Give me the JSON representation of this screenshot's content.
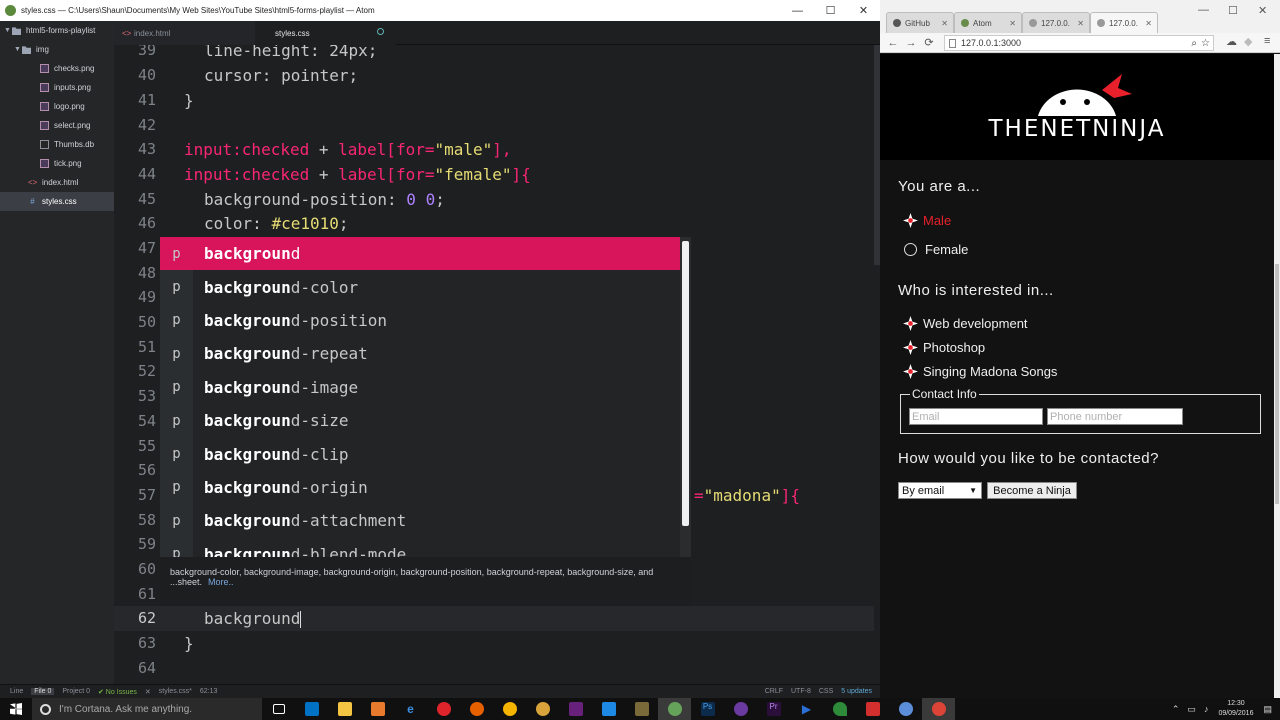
{
  "atom": {
    "title": "styles.css — C:\\Users\\Shaun\\Documents\\My Web Sites\\YouTube Sites\\html5-forms-playlist — Atom",
    "window_controls": {
      "minimize": "—",
      "maximize": "☐",
      "close": "✕"
    },
    "tree": {
      "root": "html5-forms-playlist",
      "folder": "img",
      "files": [
        "checks.png",
        "inputs.png",
        "logo.png",
        "select.png",
        "Thumbs.db",
        "tick.png"
      ],
      "root_files": [
        "index.html",
        "styles.css"
      ]
    },
    "tabs": [
      {
        "label": "index.html",
        "active": false
      },
      {
        "label": "styles.css",
        "active": true
      }
    ],
    "lines": {
      "l39": {
        "num": "39",
        "text": "line-height: 24px;"
      },
      "l40": {
        "num": "40",
        "prop": "cursor",
        "value": "pointer"
      },
      "l41": {
        "num": "41",
        "text": "}"
      },
      "l42": {
        "num": "42"
      },
      "l43": {
        "num": "43",
        "sel1": "input:checked",
        "plus": " + ",
        "sel2": "label[for=",
        "attr": "\"male\"",
        "end": "],"
      },
      "l44": {
        "num": "44",
        "sel1": "input:checked",
        "plus": " + ",
        "sel2": "label[for=",
        "attr": "\"female\"",
        "end": "]{"
      },
      "l45": {
        "num": "45",
        "prop": "background-position",
        "value": "0 0"
      },
      "l46": {
        "num": "46",
        "prop": "color",
        "value": "#ce1010"
      },
      "l47": {
        "num": "47"
      },
      "l48": {
        "num": "48"
      },
      "l49": {
        "num": "49"
      },
      "l50": {
        "num": "50"
      },
      "l51": {
        "num": "51"
      },
      "l52": {
        "num": "52"
      },
      "l53": {
        "num": "53"
      },
      "l54": {
        "num": "54"
      },
      "l55": {
        "num": "55"
      },
      "l56": {
        "num": "56"
      },
      "l57": {
        "num": "57",
        "tail_attr": "\"madona\"",
        "tail_end": "]{"
      },
      "l58": {
        "num": "58"
      },
      "l59": {
        "num": "59"
      },
      "l60": {
        "num": "60"
      },
      "l61": {
        "num": "61"
      },
      "l62": {
        "num": "62",
        "text": "background"
      },
      "l63": {
        "num": "63",
        "text": "}"
      },
      "l64": {
        "num": "64"
      }
    },
    "autocomplete": {
      "type_tag": "p",
      "typed": "backgroun",
      "items": [
        {
          "match": "backgroun",
          "rest": "d"
        },
        {
          "match": "backgroun",
          "rest": "d-color"
        },
        {
          "match": "backgroun",
          "rest": "d-position"
        },
        {
          "match": "backgroun",
          "rest": "d-repeat"
        },
        {
          "match": "backgroun",
          "rest": "d-image"
        },
        {
          "match": "backgroun",
          "rest": "d-size"
        },
        {
          "match": "backgroun",
          "rest": "d-clip"
        },
        {
          "match": "backgroun",
          "rest": "d-origin"
        },
        {
          "match": "backgroun",
          "rest": "d-attachment"
        },
        {
          "match": "backgroun",
          "rest": "d-blend-mode"
        }
      ],
      "description": "background-color, background-image, background-origin, background-position, background-repeat, background-size, and ...sheet.",
      "more": "More.."
    },
    "status": {
      "line": "Line",
      "file": "File 0",
      "project": "Project 0",
      "issues": "✔ No Issues",
      "file_name": "styles.css*",
      "pos": "62:13",
      "eol": "CRLF",
      "enc": "UTF-8",
      "grammar": "CSS",
      "updates": "5 updates"
    }
  },
  "chrome": {
    "tabs": [
      {
        "label": "GitHub"
      },
      {
        "label": "Atom"
      },
      {
        "label": "127.0.0."
      },
      {
        "label": "127.0.0.",
        "active": true
      }
    ],
    "url": "127.0.0.1:3000",
    "nav": {
      "back": "←",
      "forward": "→",
      "reload": "⟳",
      "menu": "≡"
    }
  },
  "page": {
    "logo_text": "THENETNINJA",
    "q1": "You are a...",
    "gender": [
      {
        "label": "Male",
        "checked": true
      },
      {
        "label": "Female",
        "checked": false
      }
    ],
    "q2": "Who is interested in...",
    "interests": [
      "Web development",
      "Photoshop",
      "Singing Madona Songs"
    ],
    "contact_legend": "Contact Info",
    "email_placeholder": "Email",
    "phone_placeholder": "Phone number",
    "q3": "How would you like to be contacted?",
    "contact_method": "By email",
    "submit": "Become a Ninja",
    "colors": {
      "accent": "#e8202b"
    }
  },
  "taskbar": {
    "cortana": "I'm Cortana. Ask me anything.",
    "time": "12:30",
    "date": "09/09/2016"
  }
}
